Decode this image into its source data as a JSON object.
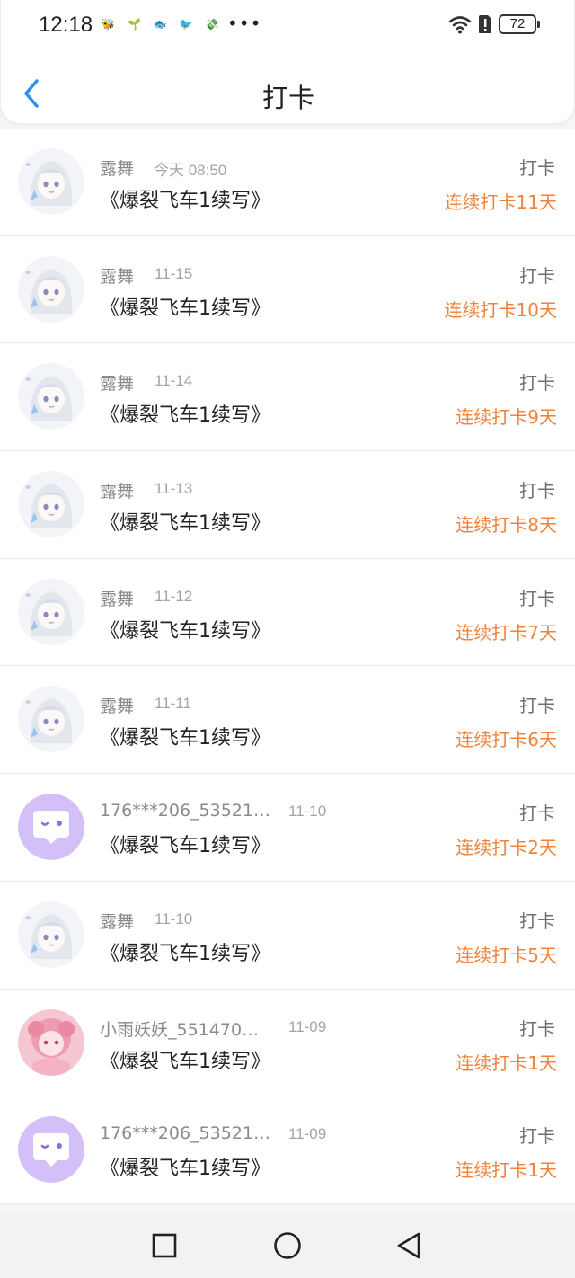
{
  "status_bar": {
    "time": "12:18",
    "more": "•••",
    "battery": "72"
  },
  "header": {
    "title": "打卡",
    "back_icon": "chevron-left-icon"
  },
  "entries": [
    {
      "user": "露舞",
      "date": "今天 08:50",
      "title": "《爆裂飞车1续写》",
      "action": "打卡",
      "streak": "连续打卡11天",
      "avatar": "anime-girl"
    },
    {
      "user": "露舞",
      "date": "11-15",
      "title": "《爆裂飞车1续写》",
      "action": "打卡",
      "streak": "连续打卡10天",
      "avatar": "anime-girl"
    },
    {
      "user": "露舞",
      "date": "11-14",
      "title": "《爆裂飞车1续写》",
      "action": "打卡",
      "streak": "连续打卡9天",
      "avatar": "anime-girl"
    },
    {
      "user": "露舞",
      "date": "11-13",
      "title": "《爆裂飞车1续写》",
      "action": "打卡",
      "streak": "连续打卡8天",
      "avatar": "anime-girl"
    },
    {
      "user": "露舞",
      "date": "11-12",
      "title": "《爆裂飞车1续写》",
      "action": "打卡",
      "streak": "连续打卡7天",
      "avatar": "anime-girl"
    },
    {
      "user": "露舞",
      "date": "11-11",
      "title": "《爆裂飞车1续写》",
      "action": "打卡",
      "streak": "连续打卡6天",
      "avatar": "anime-girl"
    },
    {
      "user": "176***206_53521…",
      "date": "11-10",
      "title": "《爆裂飞车1续写》",
      "action": "打卡",
      "streak": "连续打卡2天",
      "avatar": "purple-chat"
    },
    {
      "user": "露舞",
      "date": "11-10",
      "title": "《爆裂飞车1续写》",
      "action": "打卡",
      "streak": "连续打卡5天",
      "avatar": "anime-girl"
    },
    {
      "user": "小雨妖妖_551470…",
      "date": "11-09",
      "title": "《爆裂飞车1续写》",
      "action": "打卡",
      "streak": "连续打卡1天",
      "avatar": "pink-girl"
    },
    {
      "user": "176***206_53521…",
      "date": "11-09",
      "title": "《爆裂飞车1续写》",
      "action": "打卡",
      "streak": "连续打卡1天",
      "avatar": "purple-chat"
    }
  ],
  "nav_bar": {
    "recents_icon": "square-icon",
    "home_icon": "circle-icon",
    "back_icon": "triangle-back-icon"
  },
  "colors": {
    "accent": "#2b8ff3",
    "streak": "#f0823a",
    "purple_avatar": "#d3c0f9"
  }
}
